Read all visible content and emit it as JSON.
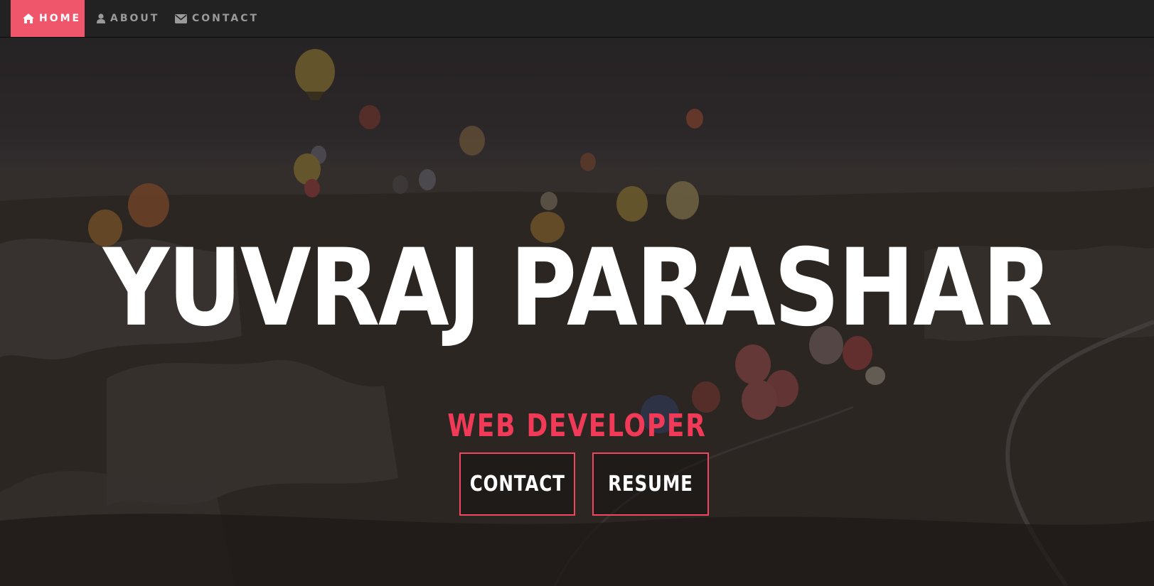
{
  "navbar": {
    "items": [
      {
        "label": "HOME",
        "icon": "home-icon",
        "active": true
      },
      {
        "label": "ABOUT",
        "icon": "user-icon",
        "active": false
      },
      {
        "label": "CONTACT",
        "icon": "envelope-icon",
        "active": false
      }
    ]
  },
  "hero": {
    "name": "YUVRAJ PARASHAR",
    "role": "WEB DEVELOPER",
    "buttons": {
      "contact": "CONTACT",
      "resume": "RESUME"
    },
    "background": "hot-air-balloons-landscape"
  },
  "colors": {
    "accent": "#f0566b",
    "role_text": "#f03a57",
    "button_border": "#f0465f",
    "navbar_bg": "#222222"
  }
}
